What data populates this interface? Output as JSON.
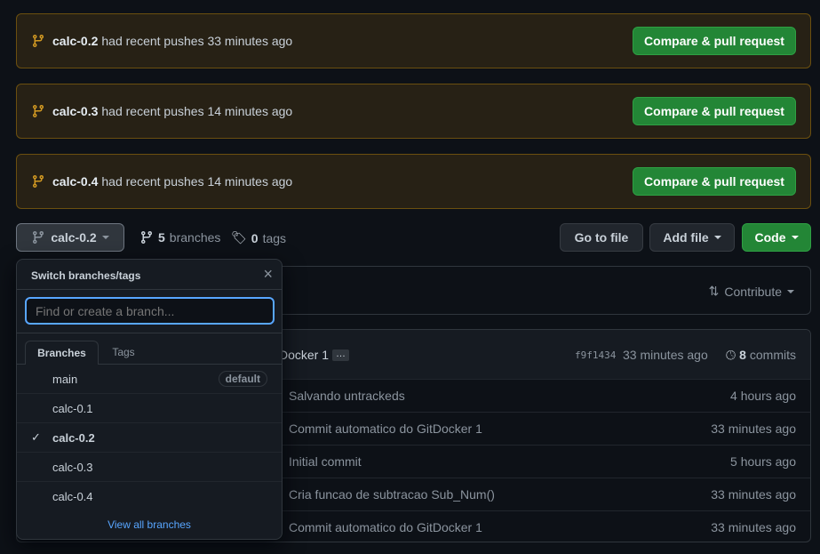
{
  "banners": [
    {
      "branch": "calc-0.2",
      "text": "had recent pushes 33 minutes ago",
      "button": "Compare & pull request"
    },
    {
      "branch": "calc-0.3",
      "text": "had recent pushes 14 minutes ago",
      "button": "Compare & pull request"
    },
    {
      "branch": "calc-0.4",
      "text": "had recent pushes 14 minutes ago",
      "button": "Compare & pull request"
    }
  ],
  "toolbar": {
    "branch": "calc-0.2",
    "branch_count": "5",
    "branches_label": "branches",
    "tag_count": "0",
    "tags_label": "tags",
    "go_to_file": "Go to file",
    "add_file": "Add file",
    "code": "Code"
  },
  "contribute": "Contribute",
  "latest_commit": {
    "message_tail": "Docker 1",
    "ellipsis": "…",
    "sha": "f9f1434",
    "time": "33 minutes ago",
    "commit_count": "8",
    "commits_label": "commits"
  },
  "files": [
    {
      "message": "Salvando untrackeds",
      "time": "4 hours ago"
    },
    {
      "message": "Commit automatico do GitDocker 1",
      "time": "33 minutes ago"
    },
    {
      "message": "Initial commit",
      "time": "5 hours ago"
    },
    {
      "message": "Cria funcao de subtracao Sub_Num()",
      "time": "33 minutes ago"
    },
    {
      "message": "Commit automatico do GitDocker 1",
      "time": "33 minutes ago"
    }
  ],
  "dropdown": {
    "title": "Switch branches/tags",
    "placeholder": "Find or create a branch...",
    "tabs": [
      "Branches",
      "Tags"
    ],
    "branches": [
      {
        "name": "main",
        "badge": "default"
      },
      {
        "name": "calc-0.1"
      },
      {
        "name": "calc-0.2",
        "selected": true
      },
      {
        "name": "calc-0.3"
      },
      {
        "name": "calc-0.4"
      }
    ],
    "view_all": "View all branches"
  },
  "colors": {
    "accent": "#238636",
    "link": "#58a6ff",
    "warning": "#d29922"
  }
}
